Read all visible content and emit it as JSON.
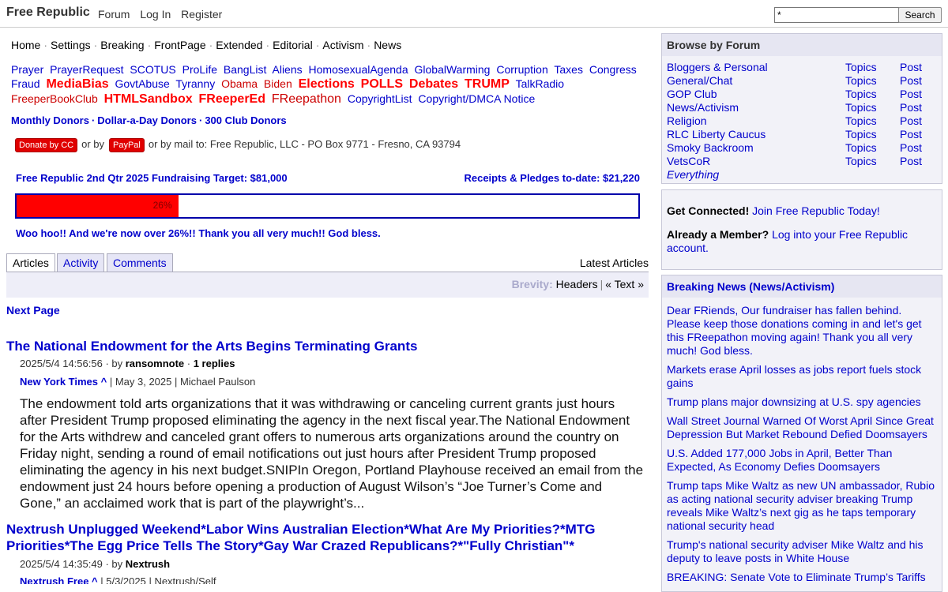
{
  "header": {
    "logo": "Free Republic",
    "nav": [
      "Forum",
      "Log In",
      "Register"
    ],
    "search_value": "*",
    "search_button": "Search"
  },
  "section_nav": [
    "Home",
    "Settings",
    "Breaking",
    "FrontPage",
    "Extended",
    "Editorial",
    "Activism",
    "News"
  ],
  "topic_links": [
    {
      "text": "Prayer",
      "style": "blue"
    },
    {
      "text": "PrayerRequest",
      "style": "blue"
    },
    {
      "text": "SCOTUS",
      "style": "blue"
    },
    {
      "text": "ProLife",
      "style": "blue"
    },
    {
      "text": "BangList",
      "style": "blue"
    },
    {
      "text": "Aliens",
      "style": "blue"
    },
    {
      "text": "HomosexualAgenda",
      "style": "blue"
    },
    {
      "text": "GlobalWarming",
      "style": "blue"
    },
    {
      "text": "Corruption",
      "style": "blue"
    },
    {
      "text": "Taxes",
      "style": "blue"
    },
    {
      "text": "Congress",
      "style": "blue"
    },
    {
      "text": "Fraud",
      "style": "blue"
    },
    {
      "text": "MediaBias",
      "style": "bigred"
    },
    {
      "text": "GovtAbuse",
      "style": "blue"
    },
    {
      "text": "Tyranny",
      "style": "blue"
    },
    {
      "text": "Obama",
      "style": "red"
    },
    {
      "text": "Biden",
      "style": "red"
    },
    {
      "text": "Elections",
      "style": "bigred"
    },
    {
      "text": "POLLS",
      "style": "bigred"
    },
    {
      "text": "Debates",
      "style": "bigred"
    },
    {
      "text": "TRUMP",
      "style": "bigred"
    },
    {
      "text": "TalkRadio",
      "style": "blue"
    },
    {
      "text": "FreeperBookClub",
      "style": "red"
    },
    {
      "text": "HTMLSandbox",
      "style": "bigred"
    },
    {
      "text": "FReeperEd",
      "style": "bigred"
    },
    {
      "text": "FReepathon",
      "style": "redbig"
    },
    {
      "text": "CopyrightList",
      "style": "blue"
    },
    {
      "text": "Copyright/DMCA Notice",
      "style": "blue"
    }
  ],
  "donors": [
    "Monthly Donors",
    "Dollar-a-Day Donors",
    "300 Club Donors"
  ],
  "donate": {
    "cc_button": "Donate by CC",
    "or1": "or by",
    "paypal_button": "PayPal",
    "mail_text": "or by mail to: Free Republic, LLC - PO Box 9771 - Fresno, CA 93794"
  },
  "fundraiser": {
    "target": "Free Republic 2nd Qtr 2025 Fundraising Target: $81,000",
    "receipts": "Receipts & Pledges to-date: $21,220",
    "percent": 26,
    "percent_label": "26%",
    "message": "Woo hoo!! And we're now over 26%!! Thank you all very much!! God bless."
  },
  "tabs": [
    "Articles",
    "Activity",
    "Comments"
  ],
  "latest_label": "Latest Articles",
  "brevity": {
    "label": "Brevity:",
    "opt1": "Headers",
    "opt2": "« Text »"
  },
  "next_page": "Next Page",
  "articles": [
    {
      "title": "The National Endowment for the Arts Begins Terminating Grants",
      "date": "2025/5/4 14:56:56",
      "by": "by",
      "author": "ransomnote",
      "replies": "1 replies",
      "source": "New York Times ^",
      "source_rest": "| May 3, 2025 | Michael Paulson",
      "body": "The endowment told arts organizations that it was withdrawing or canceling current grants just hours after President Trump proposed eliminating the agency in the next fiscal year.The National Endowment for the Arts withdrew and canceled grant offers to numerous arts organizations around the country on Friday night, sending a round of email notifications out just hours after President Trump proposed eliminating the agency in his next budget.SNIPIn Oregon, Portland Playhouse received an email from the endowment just 24 hours before opening a production of August Wilson’s “Joe Turner’s Come and Gone,” an acclaimed work that is part of the playwright’s..."
    },
    {
      "title": "Nextrush Unplugged Weekend*Labor Wins Australian Election*What Are My Priorities?*MTG Priorities*The Egg Price Tells The Story*Gay War Crazed Republicans?*\"Fully Christian\"*",
      "date": "2025/5/4 14:35:49",
      "by": "by",
      "author": "Nextrush",
      "source": "Nextrush Free ^",
      "source_rest": "| 5/3/2025 | Nextrush/Self"
    }
  ],
  "sidebar": {
    "browse_title": "Browse by Forum",
    "forums": [
      {
        "name": "Bloggers & Personal",
        "topics": "Topics",
        "post": "Post"
      },
      {
        "name": "General/Chat",
        "topics": "Topics",
        "post": "Post"
      },
      {
        "name": "GOP Club",
        "topics": "Topics",
        "post": "Post"
      },
      {
        "name": "News/Activism",
        "topics": "Topics",
        "post": "Post"
      },
      {
        "name": "Religion",
        "topics": "Topics",
        "post": "Post"
      },
      {
        "name": "RLC Liberty Caucus",
        "topics": "Topics",
        "post": "Post"
      },
      {
        "name": "Smoky Backroom",
        "topics": "Topics",
        "post": "Post"
      },
      {
        "name": "VetsCoR",
        "topics": "Topics",
        "post": "Post"
      },
      {
        "name": "Everything",
        "topics": "",
        "post": ""
      }
    ],
    "connected_label": "Get Connected!",
    "connected_link": "Join Free Republic Today!",
    "member_label": "Already a Member?",
    "member_link": "Log into your Free Republic account.",
    "breaking_title": "Breaking News (News/Activism)",
    "breaking": [
      "Dear FRiends, Our fundraiser has fallen behind. Please keep those donations coming in and let's get this FReepathon moving again! Thank you all very much! God bless.",
      "Markets erase April losses as jobs report fuels stock gains",
      "Trump plans major downsizing at U.S. spy agencies",
      "Wall Street Journal Warned Of Worst April Since Great Depression But Market Rebound Defied Doomsayers",
      "U.S. Added 177,000 Jobs in April, Better Than Expected, As Economy Defies Doomsayers",
      "Trump taps Mike Waltz as new UN ambassador, Rubio as acting national security adviser breaking Trump reveals Mike Waltz’s next gig as he taps temporary national security head",
      "Trump's national security adviser Mike Waltz and his deputy to leave posts in White House",
      "BREAKING: Senate Vote to Eliminate Trump’s Tariffs"
    ]
  }
}
